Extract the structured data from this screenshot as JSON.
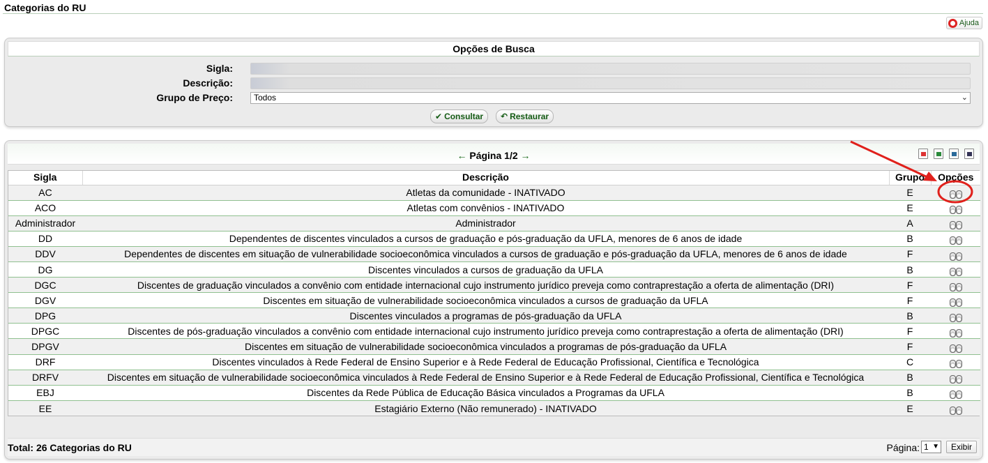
{
  "page": {
    "title": "Categorias do RU"
  },
  "help": {
    "label": "Ajuda",
    "icon": "lifebuoy-icon"
  },
  "search": {
    "title": "Opções de Busca",
    "sigla_label": "Sigla:",
    "sigla_value": "",
    "descricao_label": "Descrição:",
    "descricao_value": "",
    "grupo_label": "Grupo de Preço:",
    "grupo_value": "Todos",
    "consultar_label": "Consultar",
    "restaurar_label": "Restaurar"
  },
  "results": {
    "pager": "Página 1/2",
    "prev_arrow": "←",
    "next_arrow": "→",
    "columns": [
      "Sigla",
      "Descrição",
      "Grupo",
      "Opções"
    ],
    "rows": [
      {
        "sigla": "AC",
        "descricao": "Atletas da comunidade - INATIVADO",
        "grupo": "E"
      },
      {
        "sigla": "ACO",
        "descricao": "Atletas com convênios - INATIVADO",
        "grupo": "E"
      },
      {
        "sigla": "Administrador",
        "descricao": "Administrador",
        "grupo": "A"
      },
      {
        "sigla": "DD",
        "descricao": "Dependentes de discentes vinculados a cursos de graduação e pós-graduação da UFLA, menores de 6 anos de idade",
        "grupo": "B"
      },
      {
        "sigla": "DDV",
        "descricao": "Dependentes de discentes em situação de vulnerabilidade socioeconômica vinculados a cursos de graduação e pós-graduação da UFLA, menores de 6 anos de idade",
        "grupo": "F"
      },
      {
        "sigla": "DG",
        "descricao": "Discentes vinculados a cursos de graduação da UFLA",
        "grupo": "B"
      },
      {
        "sigla": "DGC",
        "descricao": "Discentes de graduação vinculados a convênio com entidade internacional cujo instrumento jurídico preveja como contraprestação a oferta de alimentação (DRI)",
        "grupo": "F"
      },
      {
        "sigla": "DGV",
        "descricao": "Discentes em situação de vulnerabilidade socioeconômica vinculados a cursos de graduação da UFLA",
        "grupo": "F"
      },
      {
        "sigla": "DPG",
        "descricao": "Discentes vinculados a programas de pós-graduação da UFLA",
        "grupo": "B"
      },
      {
        "sigla": "DPGC",
        "descricao": "Discentes de pós-graduação vinculados a convênio com entidade internacional cujo instrumento jurídico preveja como contraprestação a oferta de alimentação (DRI)",
        "grupo": "F"
      },
      {
        "sigla": "DPGV",
        "descricao": "Discentes em situação de vulnerabilidade socioeconômica vinculados a programas de pós-graduação da UFLA",
        "grupo": "F"
      },
      {
        "sigla": "DRF",
        "descricao": "Discentes vinculados à Rede Federal de Ensino Superior e à Rede Federal de Educação Profissional, Científica e Tecnológica",
        "grupo": "C"
      },
      {
        "sigla": "DRFV",
        "descricao": "Discentes em situação de vulnerabilidade socioeconômica vinculados à Rede Federal de Ensino Superior e à Rede Federal de Educação Profissional, Científica e Tecnológica",
        "grupo": "B"
      },
      {
        "sigla": "EBJ",
        "descricao": "Discentes da Rede Pública de Educação Básica vinculados a Programas da UFLA",
        "grupo": "B"
      },
      {
        "sigla": "EE",
        "descricao": "Estagiário Externo (Não remunerado) - INATIVADO",
        "grupo": "E"
      }
    ]
  },
  "footer": {
    "total": "Total: 26 Categorias do RU",
    "page_label": "Página:",
    "page_value": "1",
    "exibir_label": "Exibir"
  },
  "colors": {
    "accent_green": "#1b6b1b",
    "annotation_red": "#e0201b"
  }
}
